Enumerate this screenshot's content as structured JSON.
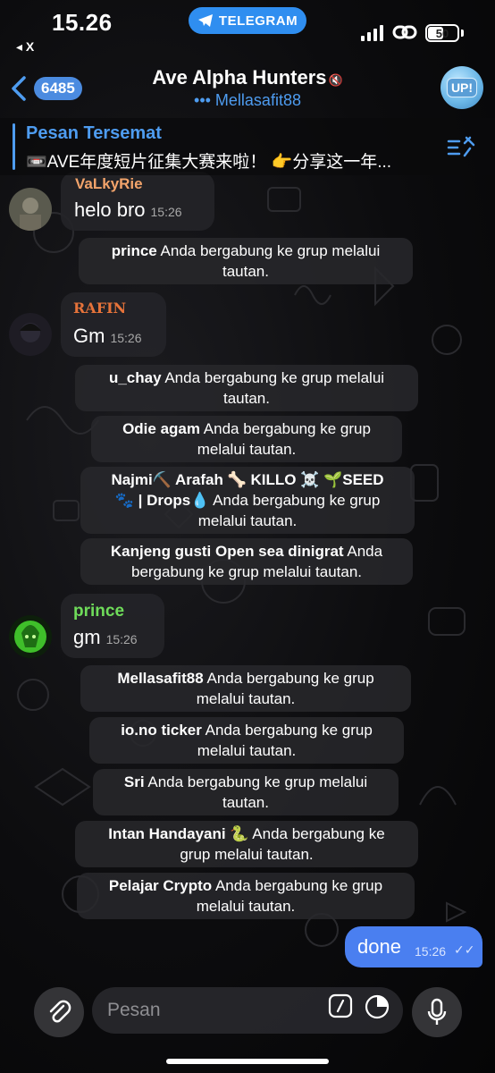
{
  "status_bar": {
    "time": "15.26",
    "back_app": "◂ X",
    "app_pill": "TELEGRAM",
    "battery": "50"
  },
  "header": {
    "unread_count": "6485",
    "title": "Ave Alpha Hunters",
    "subtitle": "••• Mellasafit88",
    "avatar_label": "UP!"
  },
  "pinned": {
    "title": "Pesan Tersemat",
    "text": "📼AVE年度短片征集大赛来啦！ 👉分享这一年..."
  },
  "messages": [
    {
      "author": "VaLkyRie",
      "author_color": "#f3a46b",
      "text": "helo bro",
      "time": "15:26"
    },
    {
      "author": "RAFIN",
      "author_color": "#e6733a",
      "text": "Gm",
      "time": "15:26"
    },
    {
      "author": "prince",
      "author_color": "#6fdc5a",
      "text": "gm",
      "time": "15:26"
    }
  ],
  "system": [
    {
      "name": "prince",
      "line1": " Anda bergabung ke grup melalui",
      "line2": "tautan."
    },
    {
      "name": "u_chay",
      "line1": " Anda bergabung ke grup melalui",
      "line2": "tautan."
    },
    {
      "name": "Odie agam",
      "line1": " Anda bergabung ke grup",
      "line2": "melalui tautan."
    },
    {
      "name": "Najmi⛏️ Arafah 🦴 KILLO ☠️ 🌱SEED",
      "name2": "🐾 | Drops💧",
      "line1": " Anda bergabung ke grup",
      "line2": "melalui tautan."
    },
    {
      "name": "Kanjeng gusti Open sea dinigrat",
      "line1": " Anda",
      "line2": "bergabung ke grup melalui tautan."
    },
    {
      "name": "Mellasafit88",
      "line1": " Anda bergabung ke grup",
      "line2": "melalui tautan."
    },
    {
      "name": "io.no ticker",
      "line1": " Anda bergabung ke grup",
      "line2": "melalui tautan."
    },
    {
      "name": "Sri",
      "line1": " Anda bergabung ke grup melalui",
      "line2": "tautan."
    },
    {
      "name": "Intan Handayani 🐍",
      "line1": " Anda bergabung ke",
      "line2": "grup melalui tautan."
    },
    {
      "name": "Pelajar Crypto",
      "line1": " Anda bergabung ke grup",
      "line2": "melalui tautan."
    }
  ],
  "outgoing": {
    "text": "done",
    "time": "15:26",
    "status": "✓✓"
  },
  "composer": {
    "placeholder": "Pesan"
  },
  "icons": [
    "telegram-icon",
    "signal-icon",
    "link-icon",
    "battery-icon",
    "back-chevron-icon",
    "mute-icon",
    "pin-list-icon",
    "attach-icon",
    "command-icon",
    "sticker-icon",
    "mic-icon"
  ]
}
